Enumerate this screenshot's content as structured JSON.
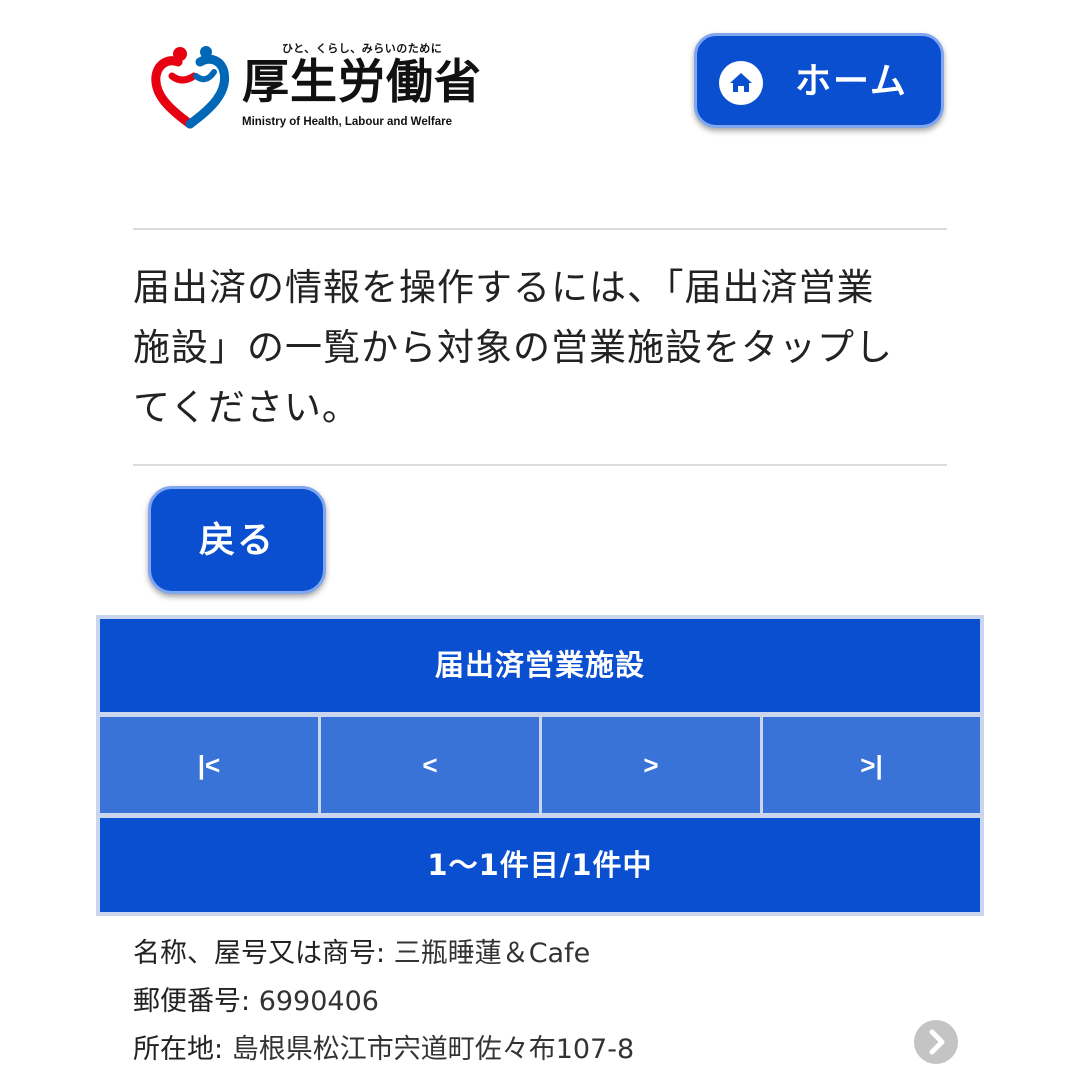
{
  "header": {
    "logo": {
      "tagline": "ひと、くらし、みらいのために",
      "name": "厚生労働省",
      "name_en": "Ministry of Health, Labour and Welfare",
      "colors": {
        "red": "#e60012",
        "blue": "#0068b7"
      }
    },
    "home_button": {
      "label": "ホーム",
      "icon": "home-icon"
    }
  },
  "instructions": {
    "text": "届出済の情報を操作するには、「届出済営業\n施設」の一覧から対象の営業施設をタップし\nてください。"
  },
  "back_button": {
    "label": "戻る"
  },
  "facilities_panel": {
    "title": "届出済営業施設",
    "pager": {
      "first": "|<",
      "prev": "<",
      "next": ">",
      "last": ">|"
    },
    "count_text": "1～1件目/1件中"
  },
  "facility": {
    "name_label": "名称、屋号又は商号:",
    "name_value": "三瓶睡蓮＆Cafe",
    "postal_label": "郵便番号:",
    "postal_value": "6990406",
    "address_label": "所在地:",
    "address_value": "島根県松江市宍道町佐々布107-8",
    "open_icon": "chevron-right-icon"
  },
  "colors": {
    "primary": "#0a4fd0",
    "pager": "#3a73d8",
    "divider": "#dcdcdc"
  }
}
